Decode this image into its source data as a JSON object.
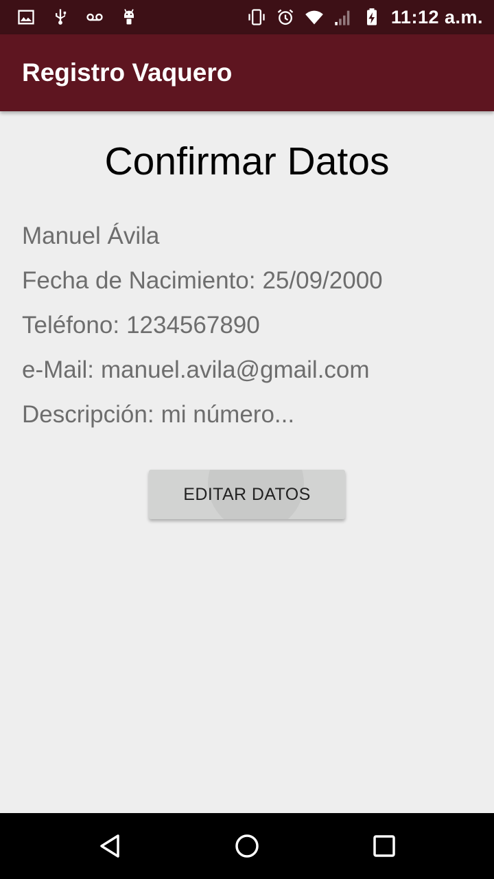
{
  "status_bar": {
    "time": "11:12 a.m.",
    "left_icons": [
      "image-icon",
      "usb-icon",
      "voicemail-icon",
      "android-icon"
    ],
    "right_icons": [
      "vibrate-icon",
      "alarm-icon",
      "wifi-icon",
      "signal-icon",
      "battery-charging-icon"
    ]
  },
  "app_bar": {
    "title": "Registro Vaquero",
    "color": "#5e1520"
  },
  "main": {
    "title": "Confirmar Datos",
    "name": "Manuel Ávila",
    "fields": {
      "birthdate_label": "Fecha de Nacimiento:",
      "birthdate_value": "25/09/2000",
      "phone_label": "Teléfono:",
      "phone_value": "1234567890",
      "email_label": "e-Mail:",
      "email_value": "manuel.avila@gmail.com",
      "description_label": "Descripción:",
      "description_value": "mi número..."
    },
    "edit_button_label": "EDITAR DATOS"
  },
  "nav_bar": {
    "icons": [
      "back-icon",
      "home-icon",
      "recents-icon"
    ]
  }
}
